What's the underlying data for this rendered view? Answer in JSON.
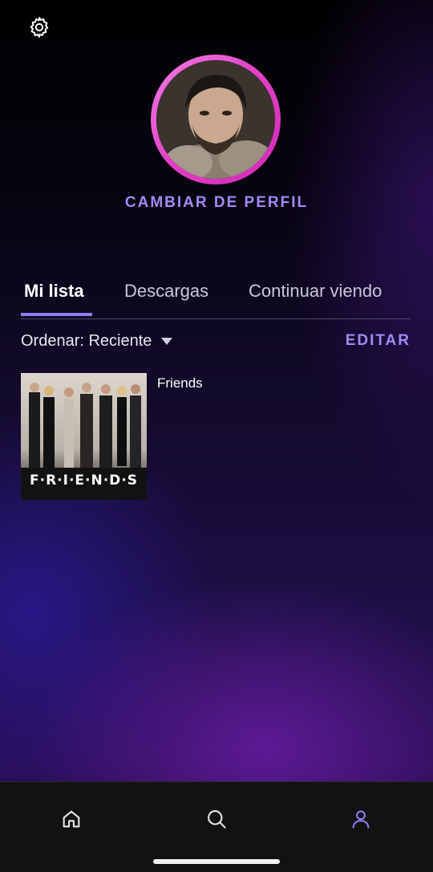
{
  "header": {
    "settings_icon": "gear-icon"
  },
  "profile": {
    "avatar_icon": "profile-avatar",
    "change_profile_label": "CAMBIAR DE PERFIL"
  },
  "tabs": [
    {
      "label": "Mi lista",
      "active": true
    },
    {
      "label": "Descargas",
      "active": false
    },
    {
      "label": "Continuar viendo",
      "active": false
    }
  ],
  "sort": {
    "label": "Ordenar: Reciente"
  },
  "edit_label": "EDITAR",
  "list": [
    {
      "title": "Friends",
      "poster_text": "F·R·I·E·N·D·S"
    }
  ],
  "bottom_nav": [
    {
      "name": "home",
      "icon": "home-icon",
      "active": false
    },
    {
      "name": "search",
      "icon": "search-icon",
      "active": false
    },
    {
      "name": "profile",
      "icon": "user-icon",
      "active": true
    }
  ],
  "colors": {
    "accent": "#a08af5",
    "avatar_ring": "#e23fc6",
    "nav_active": "#8f7cf1",
    "nav_inactive": "#e6e6e6"
  }
}
